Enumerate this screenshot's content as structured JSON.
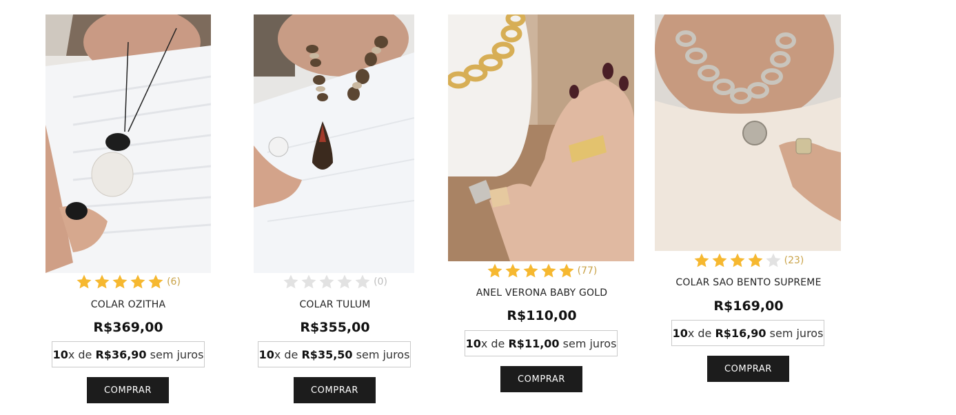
{
  "colors": {
    "star_filled": "#f6b830",
    "star_empty": "#e2e2e2",
    "count": "#c9a247",
    "button_bg": "#1c1c1c"
  },
  "products": [
    {
      "name": "COLAR OZITHA",
      "rating": 5,
      "reviews": "(6)",
      "price": "R$369,00",
      "installment": {
        "count": "10",
        "x_de": "x de ",
        "value": "R$36,90",
        "suffix": " sem juros"
      },
      "button": "COMPRAR"
    },
    {
      "name": "COLAR TULUM",
      "rating": 0,
      "reviews": "(0)",
      "price": "R$355,00",
      "installment": {
        "count": "10",
        "x_de": "x de ",
        "value": "R$35,50",
        "suffix": " sem juros"
      },
      "button": "COMPRAR"
    },
    {
      "name": "ANEL VERONA BABY GOLD",
      "rating": 5,
      "reviews": "(77)",
      "price": "R$110,00",
      "installment": {
        "count": "10",
        "x_de": "x de ",
        "value": "R$11,00",
        "suffix": " sem juros"
      },
      "button": "COMPRAR"
    },
    {
      "name": "COLAR SAO BENTO SUPREME",
      "rating": 4,
      "reviews": "(23)",
      "price": "R$169,00",
      "installment": {
        "count": "10",
        "x_de": "x de ",
        "value": "R$16,90",
        "suffix": " sem juros"
      },
      "button": "COMPRAR"
    }
  ]
}
